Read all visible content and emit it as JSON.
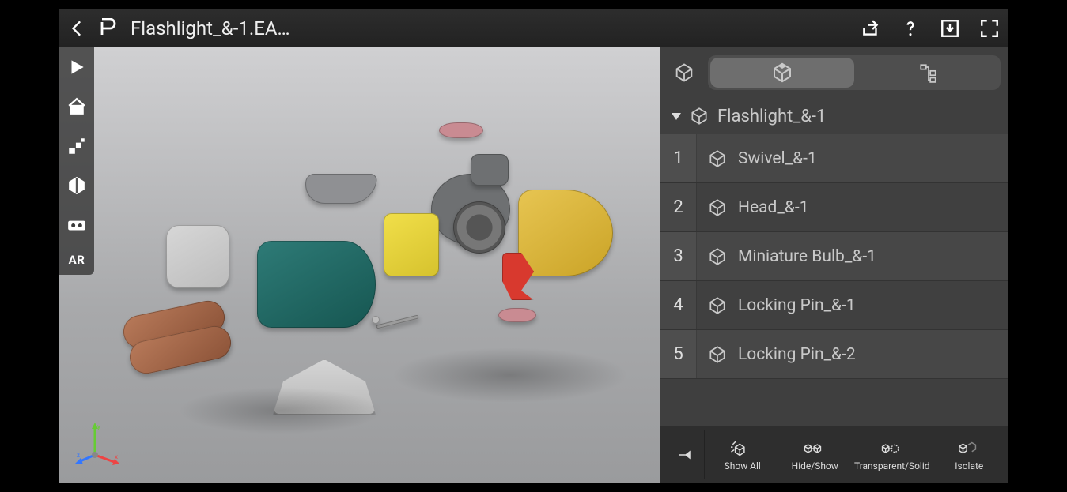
{
  "header": {
    "title": "Flashlight_&-1.EA…"
  },
  "tree": {
    "root_label": "Flashlight_&-1",
    "items": [
      {
        "index": "1",
        "label": "Swivel_&-1"
      },
      {
        "index": "2",
        "label": "Head_&-1"
      },
      {
        "index": "3",
        "label": "Miniature Bulb_&-1"
      },
      {
        "index": "4",
        "label": "Locking Pin_&-1"
      },
      {
        "index": "5",
        "label": "Locking Pin_&-2"
      }
    ]
  },
  "actions": {
    "show_all": "Show All",
    "hide_show": "Hide/Show",
    "transparent_solid": "Transparent/Solid",
    "isolate": "Isolate"
  },
  "ar_label": "AR"
}
